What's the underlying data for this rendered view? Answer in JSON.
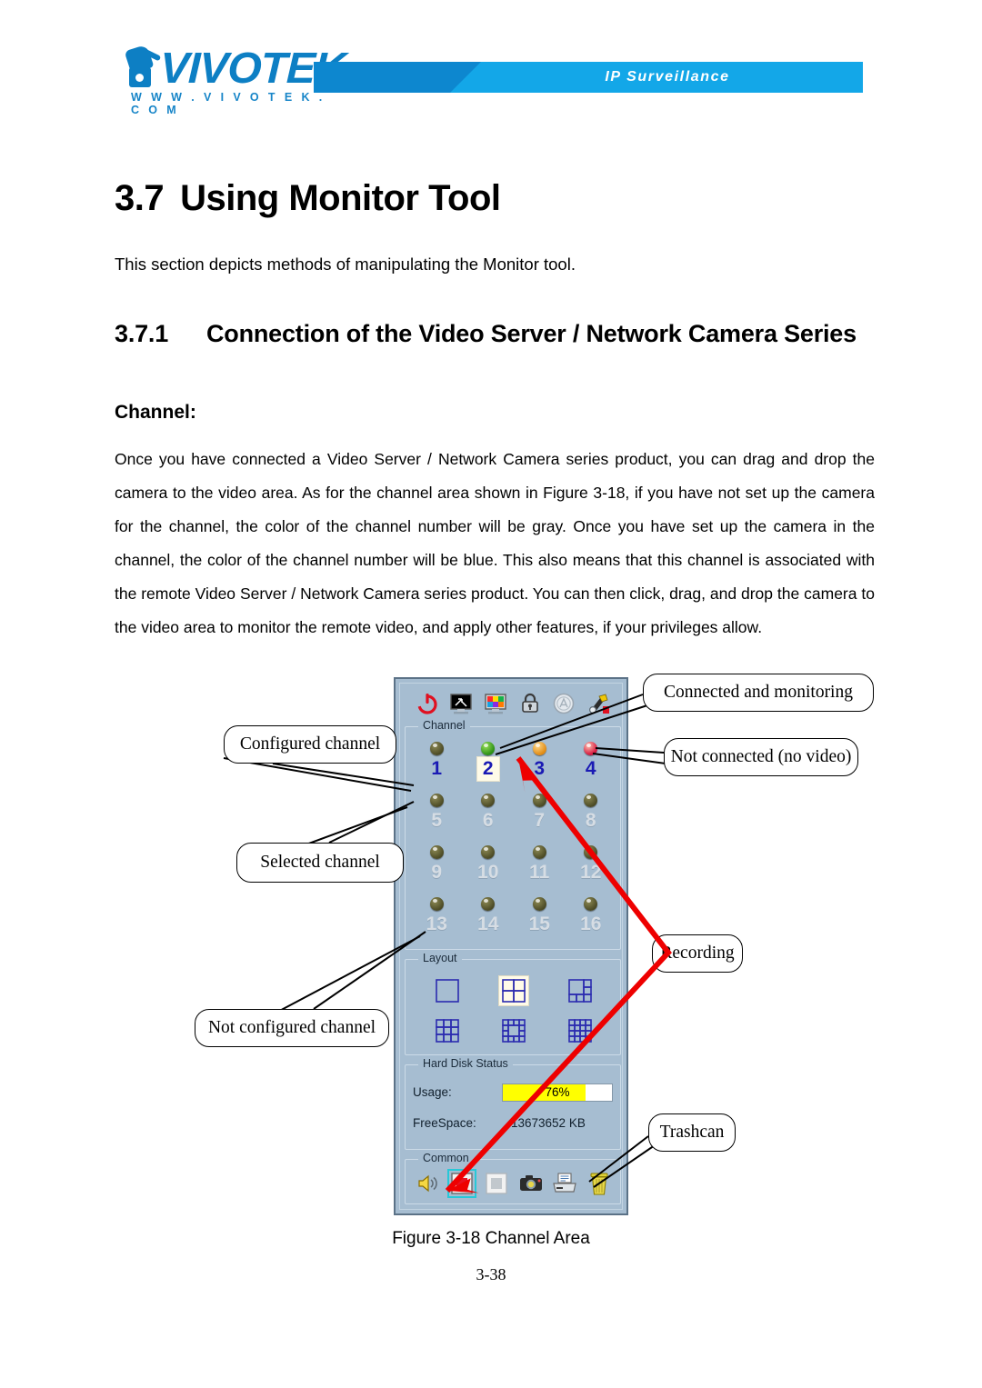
{
  "header": {
    "brand": "VIVOTEK",
    "brand_url": "W W W . V I V O T E K . C O M",
    "tagline": "IP Surveillance",
    "brand_color": "#0d7fc4",
    "banner_color": "#13a7e8"
  },
  "document": {
    "heading_number": "3.7",
    "heading_title": "Using Monitor Tool",
    "intro": "This section depicts methods of manipulating the Monitor tool.",
    "sub_heading_number": "3.7.1",
    "sub_heading_title": "Connection of the Video Server / Network Camera Series",
    "channel_label": "Channel:",
    "body_text": "Once you have connected a Video Server / Network Camera series product, you can drag and drop the camera to the video area. As for the channel area shown in Figure 3-18, if you have not set up the camera for the channel, the color of the channel number will be gray. Once you have set up the camera in the channel, the color of the channel number will be blue. This also means that this channel is associated with the remote Video Server / Network Camera series product. You can then click, drag, and drop the camera to the video area to monitor the remote video, and apply other features, if your privileges allow.",
    "figure_caption": "Figure 3-18 Channel Area",
    "page_number": "3-38"
  },
  "monitor_tool": {
    "toolbar": [
      {
        "name": "power-icon",
        "label": "Power"
      },
      {
        "name": "minimize-screen-icon",
        "label": "Minimize Screen"
      },
      {
        "name": "color-screen-icon",
        "label": "Display Settings"
      },
      {
        "name": "lock-icon",
        "label": "Lock"
      },
      {
        "name": "seal-icon",
        "label": "Watermark"
      },
      {
        "name": "config-tool-icon",
        "label": "Configuration"
      }
    ],
    "channel_group": {
      "title": "Channel",
      "channels": [
        {
          "number": "1",
          "led": "off",
          "state": "configured"
        },
        {
          "number": "2",
          "led": "green",
          "state": "selected"
        },
        {
          "number": "3",
          "led": "amber",
          "state": "configured"
        },
        {
          "number": "4",
          "led": "red",
          "state": "configured"
        },
        {
          "number": "5",
          "led": "off",
          "state": "unconfigured"
        },
        {
          "number": "6",
          "led": "off",
          "state": "unconfigured"
        },
        {
          "number": "7",
          "led": "off",
          "state": "unconfigured"
        },
        {
          "number": "8",
          "led": "off",
          "state": "unconfigured"
        },
        {
          "number": "9",
          "led": "off",
          "state": "unconfigured"
        },
        {
          "number": "10",
          "led": "off",
          "state": "unconfigured"
        },
        {
          "number": "11",
          "led": "off",
          "state": "unconfigured"
        },
        {
          "number": "12",
          "led": "off",
          "state": "unconfigured"
        },
        {
          "number": "13",
          "led": "off",
          "state": "unconfigured"
        },
        {
          "number": "14",
          "led": "off",
          "state": "unconfigured"
        },
        {
          "number": "15",
          "led": "off",
          "state": "unconfigured"
        },
        {
          "number": "16",
          "led": "off",
          "state": "unconfigured"
        }
      ],
      "configured_number_color": "#1a1ab4",
      "unconfigured_number_color": "#d6dde4"
    },
    "layout_group": {
      "title": "Layout",
      "options": [
        {
          "name": "layout-1-icon",
          "label": "1 view",
          "selected": false
        },
        {
          "name": "layout-4-icon",
          "label": "4 views",
          "selected": true
        },
        {
          "name": "layout-6-icon",
          "label": "6 views",
          "selected": false
        },
        {
          "name": "layout-9-icon",
          "label": "9 views",
          "selected": false
        },
        {
          "name": "layout-10-icon",
          "label": "10 views",
          "selected": false
        },
        {
          "name": "layout-16-icon",
          "label": "16 views",
          "selected": false
        }
      ]
    },
    "hdd_group": {
      "title": "Hard Disk Status",
      "usage_label": "Usage:",
      "usage_percent": "76%",
      "usage_value": 76,
      "usage_bar_color": "#ffff00",
      "freespace_label": "FreeSpace:",
      "freespace_value": "13673652 KB"
    },
    "common_group": {
      "title": "Common",
      "buttons": [
        {
          "name": "speaker-icon",
          "label": "Audio",
          "selected": false
        },
        {
          "name": "record-icon",
          "label": "Record",
          "selected": true
        },
        {
          "name": "stop-icon",
          "label": "Stop",
          "selected": false
        },
        {
          "name": "snapshot-icon",
          "label": "Snapshot",
          "selected": false
        },
        {
          "name": "print-icon",
          "label": "Print",
          "selected": false
        },
        {
          "name": "trash-icon",
          "label": "Trashcan",
          "selected": false
        }
      ]
    }
  },
  "callouts": {
    "configured": "Configured channel",
    "selected": "Selected channel",
    "not_configured": "Not configured channel",
    "connected": "Connected and monitoring",
    "not_connected": "Not connected (no video)",
    "recording": "Recording",
    "trashcan": "Trashcan",
    "arrow_color": "#ee0000"
  }
}
